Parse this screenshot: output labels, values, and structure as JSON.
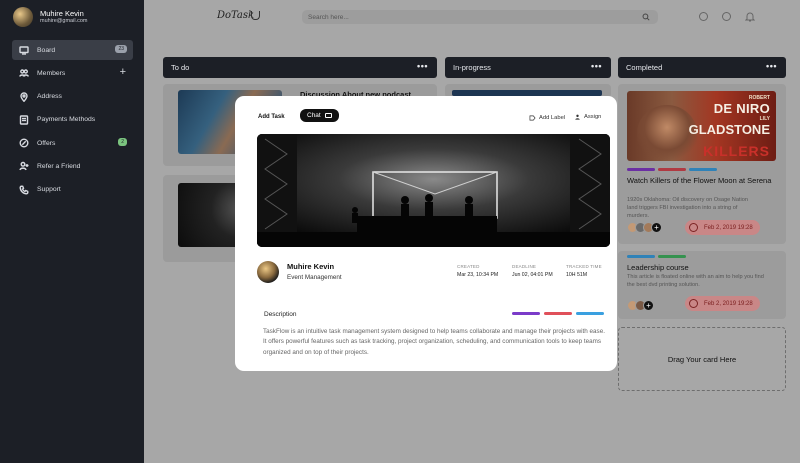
{
  "sidebar": {
    "profile": {
      "name": "Muhire Kevin",
      "email": "muhire@gmail.com"
    },
    "items": [
      {
        "label": "Board",
        "icon": "board-icon",
        "badge": "23",
        "active": true
      },
      {
        "label": "Members",
        "icon": "members-icon",
        "action": "+"
      },
      {
        "label": "Address",
        "icon": "location-pin-icon"
      },
      {
        "label": "Payments Methods",
        "icon": "card-icon"
      },
      {
        "label": "Offers",
        "icon": "offer-icon",
        "badge": "2"
      },
      {
        "label": "Refer a Friend",
        "icon": "refer-icon"
      },
      {
        "label": "Support",
        "icon": "phone-icon"
      }
    ]
  },
  "header": {
    "logo": "DoTask",
    "search_placeholder": "Search here..."
  },
  "columns": {
    "todo": {
      "label": "To do",
      "card_title": "Discussion About new podcast"
    },
    "inprogress": {
      "label": "In-progress"
    },
    "completed": {
      "label": "Completed",
      "poster": {
        "line1": "ROBERT",
        "line2": "DE NIRO",
        "line3": "LILY",
        "line4": "GLADSTONE",
        "line5": "KILLERS"
      },
      "cards": [
        {
          "title": "Watch Killers of the Flower Moon at Serena",
          "desc": "1920s Oklahoma: Oil discovery on Osage Nation land triggers FBI investigation into a string of murders.",
          "date": "Feb 2, 2019 19:28"
        },
        {
          "title": "Leadership course",
          "desc": "This article is floated online with an aim to help you find the best dvd printing solution.",
          "date": "Feb 2, 2019 19:28"
        }
      ],
      "drop_label": "Drag Your card Here"
    }
  },
  "modal": {
    "add_task": "Add Task",
    "chat": "Chat",
    "add_label": "Add Label",
    "assign": "Assign",
    "user_name": "Muhire Kevin",
    "user_role": "Event Management",
    "meta": [
      {
        "label": "CREATED",
        "value": "Mar 23, 10:34 PM"
      },
      {
        "label": "DEADLINE",
        "value": "Jun 02, 04:01 PM"
      },
      {
        "label": "TRACKED TIME",
        "value": "10H 51M"
      }
    ],
    "description_title": "Description",
    "description": "TaskFlow is an intuitive task management system designed to help teams collaborate and manage their projects with ease. It offers powerful features such as task tracking, project organization, scheduling, and communication tools to keep teams organized and on top of their projects."
  },
  "colors": {
    "purple": "#7b3bc9",
    "red": "#e0505a",
    "blue": "#3aa0e0",
    "green": "#3fb56a",
    "sidebar_bg": "#1c1f26"
  }
}
